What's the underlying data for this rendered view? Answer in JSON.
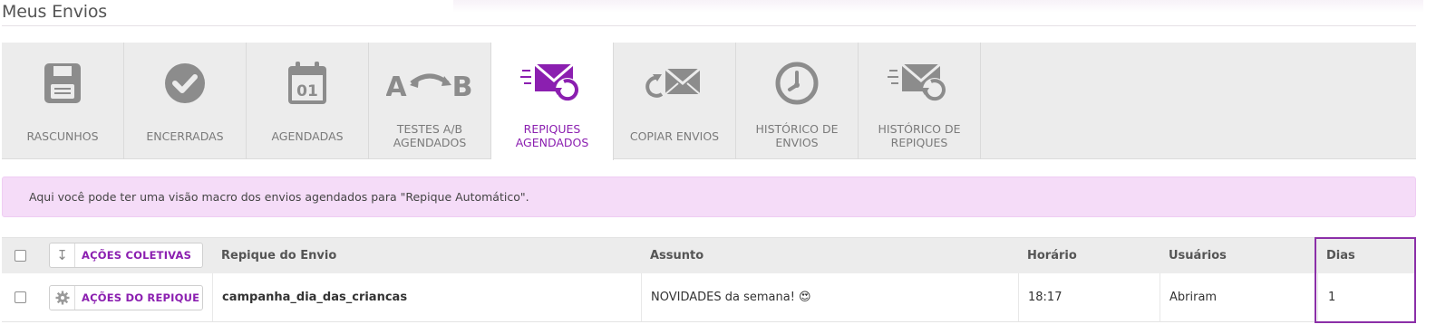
{
  "page": {
    "title": "Meus Envios"
  },
  "tabs": [
    {
      "label": "RASCUNHOS",
      "icon": "floppy-disk-icon",
      "active": false
    },
    {
      "label": "ENCERRADAS",
      "icon": "check-circle-icon",
      "active": false
    },
    {
      "label": "AGENDADAS",
      "icon": "calendar-icon",
      "active": false
    },
    {
      "label": "TESTES A/B\nAGENDADOS",
      "icon": "ab-test-icon",
      "active": false
    },
    {
      "label": "REPIQUES\nAGENDADOS",
      "icon": "scheduled-resend-icon",
      "active": true
    },
    {
      "label": "COPIAR ENVIOS",
      "icon": "copy-send-icon",
      "active": false
    },
    {
      "label": "HISTÓRICO DE\nENVIOS",
      "icon": "clock-icon",
      "active": false
    },
    {
      "label": "HISTÓRICO DE\nREPIQUES",
      "icon": "resend-history-icon",
      "active": false
    }
  ],
  "calendar_day": "01",
  "ab_letters": {
    "a": "A",
    "b": "B"
  },
  "info_message": "Aqui você pode ter uma visão macro dos envios agendados para \"Repique Automático\".",
  "table": {
    "bulk_actions_label": "AÇÕES COLETIVAS",
    "headers": {
      "repique": "Repique do Envio",
      "assunto": "Assunto",
      "horario": "Horário",
      "usuarios": "Usuários",
      "dias": "Dias"
    },
    "rows": [
      {
        "actions_label": "AÇÕES DO REPIQUE",
        "repique": "campanha_dia_das_criancas",
        "assunto": "NOVIDADES da semana! 😍",
        "horario": "18:17",
        "usuarios": "Abriram",
        "dias": "1"
      }
    ]
  },
  "colors": {
    "accent": "#8b1fb0",
    "banner": "#f5dcf8",
    "tab_bar": "#ececec",
    "icon_gray": "#8c8c8c"
  }
}
